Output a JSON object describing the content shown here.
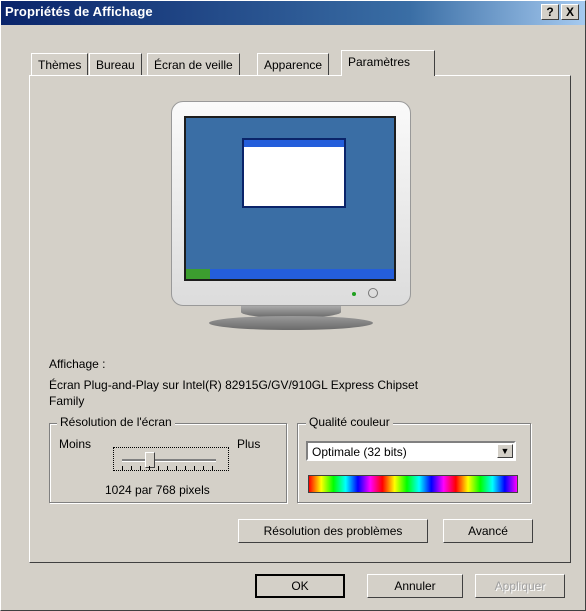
{
  "window": {
    "title": "Propriétés de Affichage",
    "help_label": "?",
    "close_label": "X"
  },
  "tabs": [
    {
      "label": "Thèmes"
    },
    {
      "label": "Bureau"
    },
    {
      "label": "Écran de veille"
    },
    {
      "label": "Apparence"
    },
    {
      "label": "Paramètres"
    }
  ],
  "display": {
    "label": "Affichage :",
    "device_line1": "Écran Plug-and-Play sur Intel(R) 82915G/GV/910GL Express Chipset",
    "device_line2": "Family"
  },
  "resolution": {
    "title": "Résolution de l'écran",
    "less": "Moins",
    "more": "Plus",
    "value_text": "1024 par 768 pixels",
    "slider_position": 0.3
  },
  "color_quality": {
    "title": "Qualité couleur",
    "selected": "Optimale (32 bits)"
  },
  "buttons": {
    "troubleshoot": "Résolution des problèmes",
    "advanced": "Avancé",
    "ok": "OK",
    "cancel": "Annuler",
    "apply": "Appliquer"
  },
  "colors": {
    "titlebar": "#0a246a",
    "face": "#d4d0c8"
  }
}
